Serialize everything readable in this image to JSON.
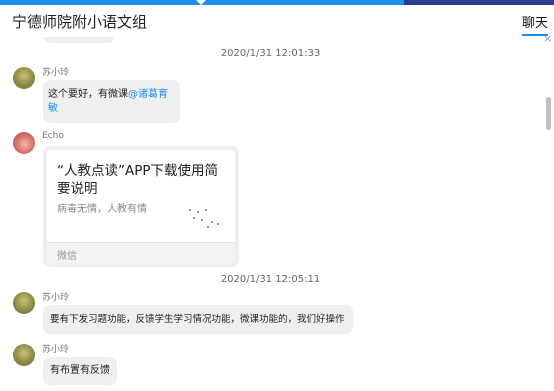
{
  "header": {
    "title": "宁德师院附小语文组",
    "tab_label": "聊天",
    "close_symbol": "×"
  },
  "messages": [
    {
      "type": "timestamp",
      "text": "2020/1/31 12:01:33"
    },
    {
      "type": "text",
      "sender": "苏小玲",
      "text": "这个要好，有微课",
      "mention": "@诸葛育敏"
    },
    {
      "type": "card",
      "sender": "Echo",
      "title": "“人教点读”APP下载使用简要说明",
      "description": "病毒无情，人教有情",
      "source": "微信"
    },
    {
      "type": "timestamp",
      "text": "2020/1/31 12:05:11"
    },
    {
      "type": "text",
      "sender": "苏小玲",
      "text": "要有下发习题功能，反馈学生学习情况功能，微课功能的，我们好操作"
    },
    {
      "type": "text",
      "sender": "苏小玲",
      "text": "有布置有反馈"
    }
  ],
  "colors": {
    "accent": "#1f8ef0",
    "bubble": "#efefef"
  },
  "icons": {
    "close": "close-icon",
    "scroll": "scrollbar-thumb"
  }
}
